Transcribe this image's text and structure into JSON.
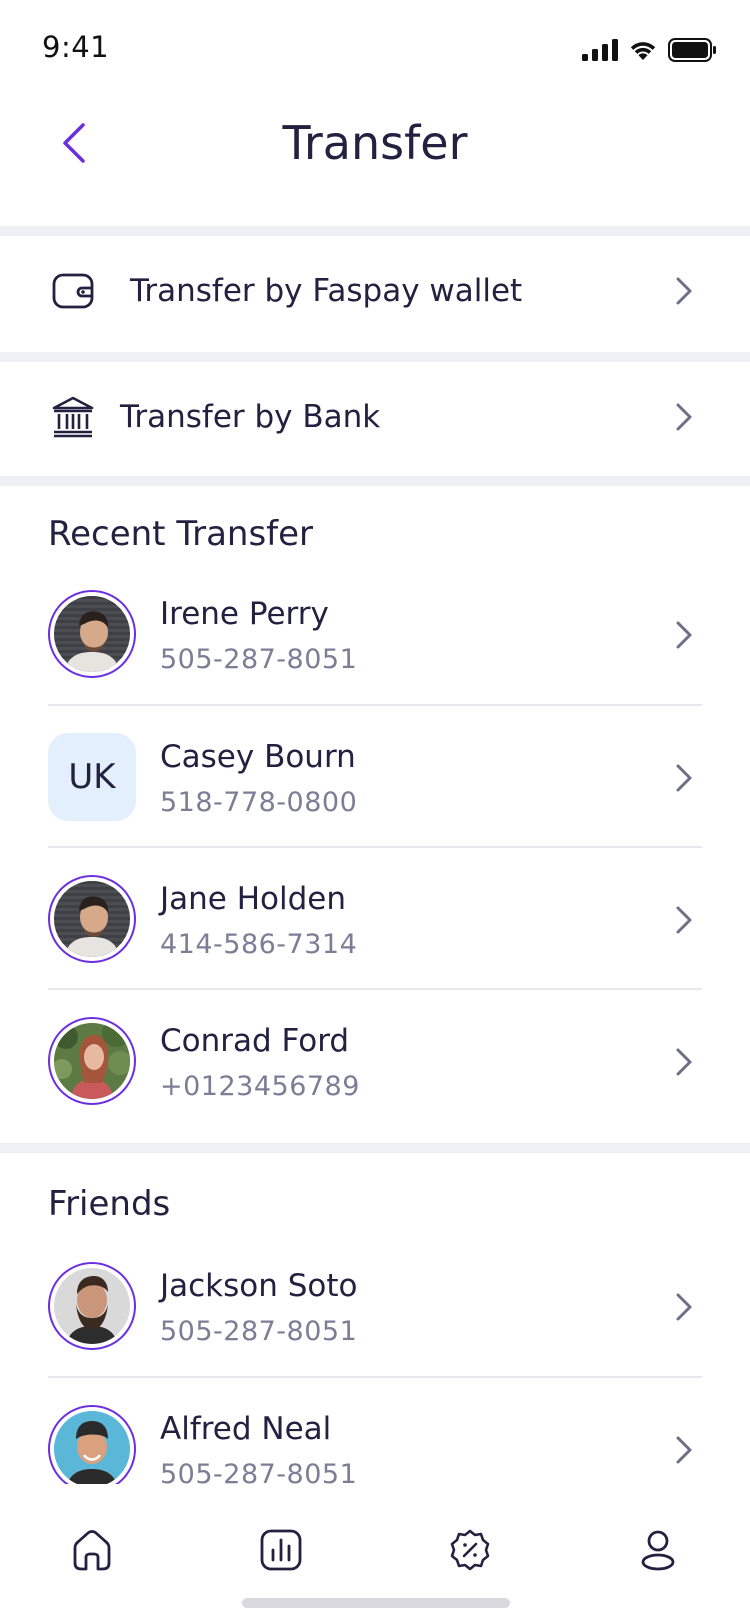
{
  "status": {
    "time": "9:41"
  },
  "header": {
    "title": "Transfer"
  },
  "options": [
    {
      "label": "Transfer by Faspay wallet",
      "icon": "wallet-icon"
    },
    {
      "label": "Transfer by Bank",
      "icon": "bank-icon"
    }
  ],
  "recent": {
    "title": "Recent Transfer",
    "items": [
      {
        "name": "Irene Perry",
        "phone": "505-287-8051",
        "avatar": "photo"
      },
      {
        "name": "Casey Bourn",
        "phone": "518-778-0800",
        "avatar": "initials",
        "initials": "UK"
      },
      {
        "name": "Jane Holden",
        "phone": "414-586-7314",
        "avatar": "photo"
      },
      {
        "name": "Conrad Ford",
        "phone": "+0123456789",
        "avatar": "photo"
      }
    ]
  },
  "friends": {
    "title": "Friends",
    "items": [
      {
        "name": "Jackson Soto",
        "phone": "505-287-8051",
        "avatar": "photo"
      },
      {
        "name": "Alfred Neal",
        "phone": "505-287-8051",
        "avatar": "photo"
      }
    ]
  },
  "tabbar": {
    "icons": [
      "home-icon",
      "chart-icon",
      "discount-icon",
      "profile-icon"
    ]
  },
  "colors": {
    "accent": "#6B2EE0",
    "text": "#242040",
    "muted": "#7D7D95",
    "separator": "#EEF0F6",
    "initials_bg": "#E3EFFC"
  }
}
